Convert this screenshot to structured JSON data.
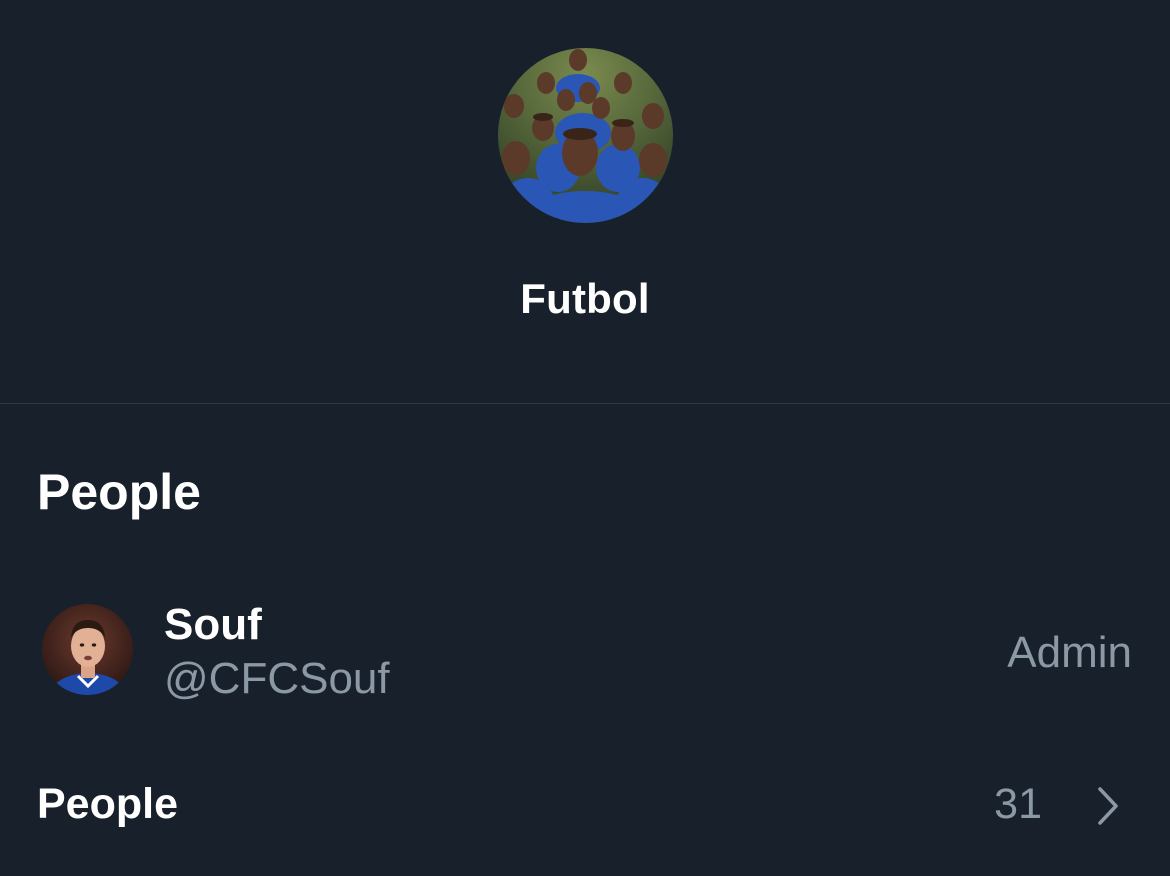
{
  "group": {
    "name": "Futbol",
    "avatar_icon": "group-photo"
  },
  "people_section": {
    "title": "People"
  },
  "members": [
    {
      "name": "Souf",
      "handle": "@CFCSouf",
      "role": "Admin",
      "avatar_icon": "user-avatar"
    }
  ],
  "people_link": {
    "label": "People",
    "count": "31",
    "icon": "chevron-right-icon"
  },
  "colors": {
    "background": "#18202b",
    "divider": "#303944",
    "secondary_text": "#8b98a5",
    "primary_text": "#ffffff"
  }
}
